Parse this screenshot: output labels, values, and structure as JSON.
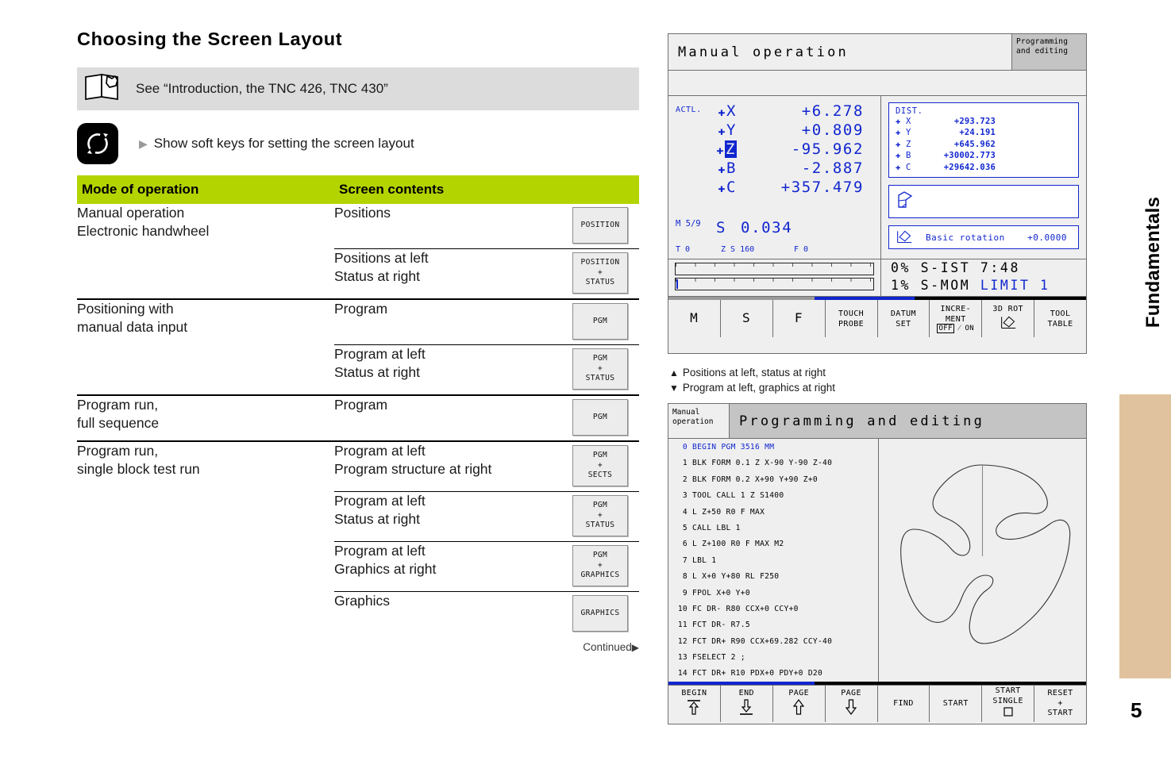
{
  "page": {
    "title": "Choosing the Screen Layout",
    "side_title": "Fundamentals",
    "page_number": "5",
    "continued": "Continued",
    "tab_color": "#e0c39e",
    "accent_green": "#b4d400"
  },
  "note": {
    "text": "See “Introduction, the TNC 426, TNC 430”",
    "icon": "open-book-icon"
  },
  "softkey_note": {
    "text": "Show soft keys for setting the screen layout",
    "icon": "screen-layout-key-icon",
    "bullet": "▶"
  },
  "table": {
    "header": {
      "mode": "Mode of operation",
      "contents": "Screen contents"
    },
    "rows": [
      {
        "mode": "Manual operation\nElectronic handwheel",
        "contents": "Positions",
        "key": [
          "POSITION"
        ]
      },
      {
        "mode": "",
        "contents": "Positions at left\nStatus at right",
        "key": [
          "POSITION",
          "+",
          "STATUS"
        ]
      },
      {
        "mode": "Positioning with\nmanual data input",
        "contents": "Program",
        "key": [
          "PGM"
        ]
      },
      {
        "mode": "",
        "contents": "Program at left\nStatus at right",
        "key": [
          "PGM",
          "+",
          "STATUS"
        ]
      },
      {
        "mode": "Program run,\nfull sequence",
        "contents": "Program",
        "key": [
          "PGM"
        ]
      },
      {
        "mode": "Program run,\nsingle block test run",
        "contents": "Program at left\nProgram structure at right",
        "key": [
          "PGM",
          "+",
          "SECTS"
        ]
      },
      {
        "mode": "",
        "contents": "Program at left\nStatus at right",
        "key": [
          "PGM",
          "+",
          "STATUS"
        ]
      },
      {
        "mode": "",
        "contents": "Program at left\nGraphics at right",
        "key": [
          "PGM",
          "+",
          "GRAPHICS"
        ]
      },
      {
        "mode": "",
        "contents": "Graphics",
        "key": [
          "GRAPHICS"
        ]
      }
    ]
  },
  "caption": {
    "line1": "Positions at left, status at right",
    "line2": "Program at left, graphics at right",
    "up": "▲",
    "down": "▼"
  },
  "tnc_top": {
    "mode_title": "Manual operation",
    "mode_right": "Programming\nand editing",
    "actl_label": "ACTL.",
    "axes": [
      {
        "name": "X",
        "value": "+6.278",
        "highlight": false
      },
      {
        "name": "Y",
        "value": "+0.809",
        "highlight": false
      },
      {
        "name": "Z",
        "value": "-95.962",
        "highlight": true
      },
      {
        "name": "B",
        "value": "-2.887",
        "highlight": false
      },
      {
        "name": "C",
        "value": "+357.479",
        "highlight": false
      }
    ],
    "m_label": "M 5/9",
    "s_label": "S",
    "s_value": "0.034",
    "bottom_line": [
      "T 0",
      "Z S 160",
      "F 0"
    ],
    "dist": {
      "title": "DIST.",
      "rows": [
        {
          "axis": "X",
          "value": "+293.723"
        },
        {
          "axis": "Y",
          "value": "+24.191"
        },
        {
          "axis": "Z",
          "value": "+645.962"
        },
        {
          "axis": "B",
          "value": "+30002.773"
        },
        {
          "axis": "C",
          "value": "+29642.036"
        }
      ]
    },
    "basic_rotation_label": "Basic rotation",
    "basic_rotation_value": "+0.0000",
    "override": {
      "line1_pct": "0%",
      "line1_txt": "S-IST",
      "line1_val": "7:48",
      "line2_pct": "1%",
      "line2_txt": "S-MOM",
      "line2_val": "LIMIT 1"
    },
    "softkeys": [
      {
        "l1": "M",
        "l2": "",
        "style": "big"
      },
      {
        "l1": "S",
        "l2": "",
        "style": "big"
      },
      {
        "l1": "F",
        "l2": "",
        "style": "big"
      },
      {
        "l1": "TOUCH",
        "l2": "PROBE",
        "style": ""
      },
      {
        "l1": "DATUM",
        "l2": "SET",
        "style": ""
      },
      {
        "l1": "INCRE-",
        "l2": "MENT",
        "l3": "OFF",
        "l4": "ON",
        "style": "toggle"
      },
      {
        "l1": "3D ROT",
        "l2": "",
        "style": "icon"
      },
      {
        "l1": "TOOL",
        "l2": "TABLE",
        "style": ""
      }
    ]
  },
  "tnc_bot": {
    "left_tab": "Manual\noperation",
    "title": "Programming and editing",
    "program": [
      {
        "n": "0",
        "t": "BEGIN PGM 3516 MM"
      },
      {
        "n": "1",
        "t": "BLK FORM 0.1 Z X-90 Y-90 Z-40"
      },
      {
        "n": "2",
        "t": "BLK FORM 0.2 X+90 Y+90 Z+0"
      },
      {
        "n": "3",
        "t": "TOOL CALL 1 Z S1400"
      },
      {
        "n": "4",
        "t": "L Z+50 R0 F MAX"
      },
      {
        "n": "5",
        "t": "CALL LBL 1"
      },
      {
        "n": "6",
        "t": "L Z+100 R0 F MAX M2"
      },
      {
        "n": "7",
        "t": "LBL 1"
      },
      {
        "n": "8",
        "t": "L X+0 Y+80 RL F250"
      },
      {
        "n": "9",
        "t": "FPOL X+0 Y+0"
      },
      {
        "n": "10",
        "t": "FC DR- R80 CCX+0 CCY+0"
      },
      {
        "n": "11",
        "t": "FCT DR- R7.5"
      },
      {
        "n": "12",
        "t": "FCT DR+ R90 CCX+69.282 CCY-40"
      },
      {
        "n": "13",
        "t": "FSELECT 2 ;"
      },
      {
        "n": "14",
        "t": "FCT DR+ R10 PDX+0 PDY+0 D20"
      }
    ],
    "softkeys": [
      {
        "l1": "BEGIN",
        "icon": "arrow-up-to-line-icon"
      },
      {
        "l1": "END",
        "icon": "arrow-down-to-line-icon"
      },
      {
        "l1": "PAGE",
        "icon": "arrow-up-icon"
      },
      {
        "l1": "PAGE",
        "icon": "arrow-down-icon"
      },
      {
        "l1": "FIND",
        "icon": ""
      },
      {
        "l1": "START",
        "icon": ""
      },
      {
        "l1": "START",
        "l2": "SINGLE",
        "icon": "square-icon"
      },
      {
        "l1": "RESET",
        "l2": "+",
        "l3": "START",
        "icon": ""
      }
    ]
  }
}
